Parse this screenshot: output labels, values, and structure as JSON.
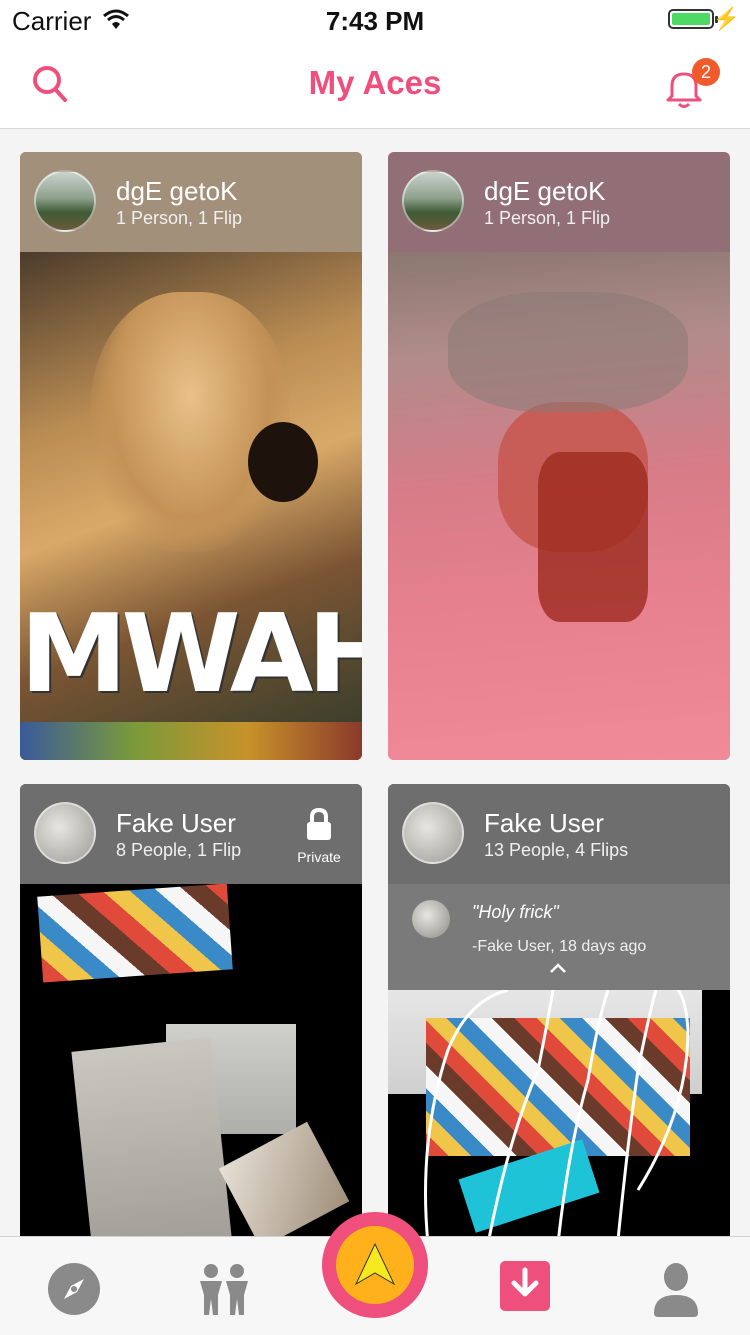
{
  "status_bar": {
    "carrier": "Carrier",
    "time": "7:43 PM"
  },
  "header": {
    "title": "My Aces",
    "notification_count": "2"
  },
  "cards": [
    {
      "name": "dgE getoK",
      "subtitle": "1 Person, 1 Flip",
      "image_text": "MWAH"
    },
    {
      "name": "dgE getoK",
      "subtitle": "1 Person, 1 Flip"
    },
    {
      "name": "Fake User",
      "subtitle": "8 People, 1 Flip",
      "lock_label": "Private"
    },
    {
      "name": "Fake User",
      "subtitle": "13 People, 4 Flips",
      "quote": "\"Holy frick\"",
      "quote_author": "-Fake User, 18 days ago"
    }
  ],
  "tabs": [
    {
      "icon": "compass-icon"
    },
    {
      "icon": "people-icon"
    },
    {
      "icon": "ace-logo-icon"
    },
    {
      "icon": "download-icon"
    },
    {
      "icon": "profile-icon"
    }
  ],
  "colors": {
    "accent": "#ef4f7c",
    "badge": "#f15a2b",
    "center_inner": "#ffb11b"
  }
}
